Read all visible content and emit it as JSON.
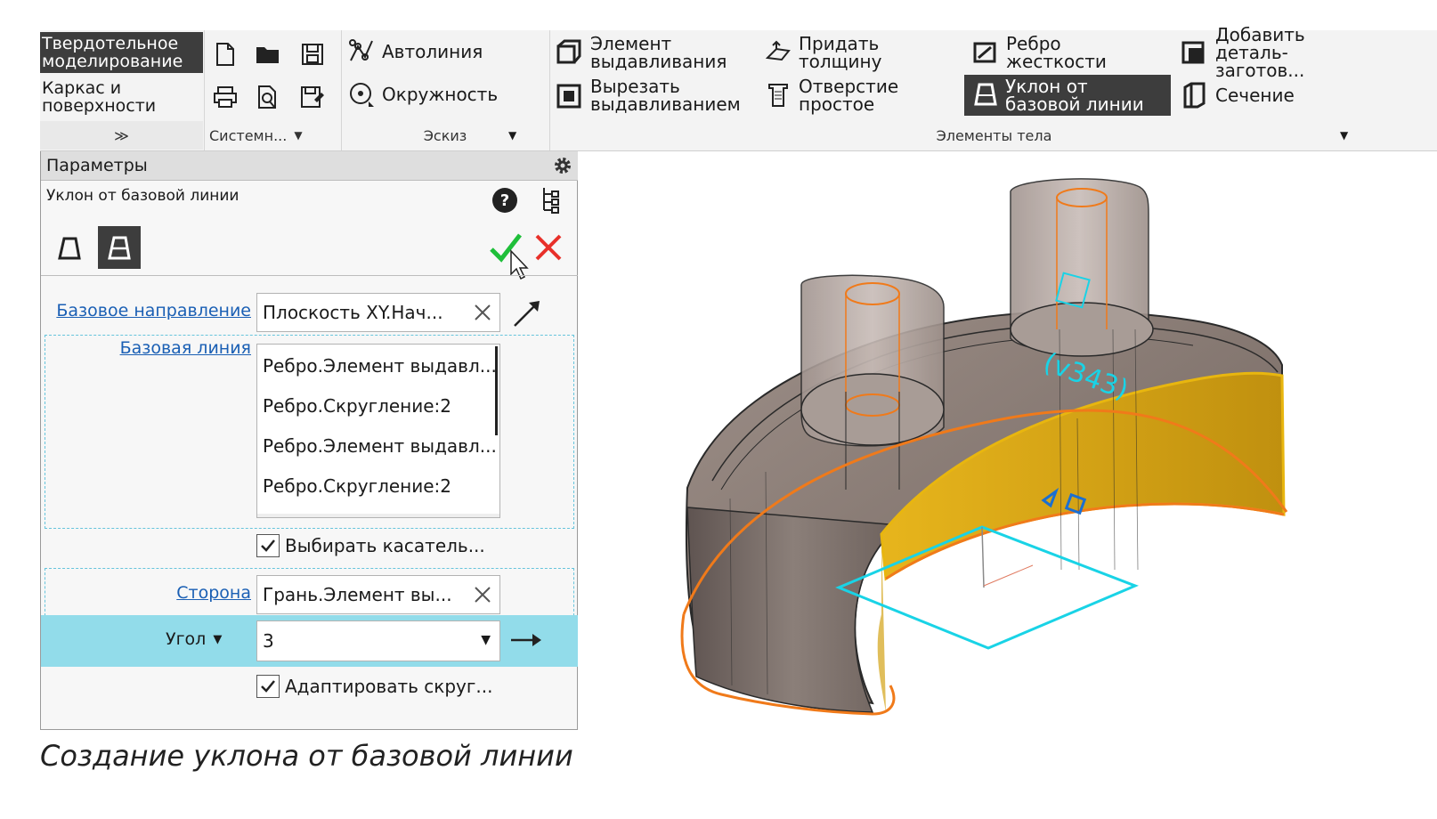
{
  "ribbon": {
    "modes": [
      "Твердотельное моделирование",
      "Каркас и поверхности"
    ],
    "expand_glyph": "≫",
    "system_group_label": "Системн...",
    "sketch": {
      "autoline": "Автолиния",
      "circle": "Окружность",
      "group_label": "Эскиз"
    },
    "body": {
      "extrude": "Элемент выдавливания",
      "cut_extrude": "Вырезать выдавливанием",
      "thicken": "Придать толщину",
      "hole": "Отверстие простое",
      "rib": "Ребро жесткости",
      "draft_base_line": "Уклон от базовой линии",
      "add_blank": "Добавить деталь-заготов...",
      "section": "Сечение",
      "group_label": "Элементы тела"
    },
    "icons": [
      "new-file-icon",
      "open-folder-icon",
      "save-icon",
      "print-icon",
      "preview-icon",
      "save-as-icon",
      "autoline-icon",
      "circle-icon",
      "extrude-icon",
      "cut-extrude-icon",
      "thicken-icon",
      "hole-icon",
      "rib-icon",
      "draft-icon",
      "add-blank-icon",
      "section-icon"
    ]
  },
  "panel": {
    "header": "Параметры",
    "operation": "Уклон от базовой линии",
    "base_direction": {
      "label": "Базовое направление",
      "value": "Плоскость XY.Нач..."
    },
    "base_line": {
      "label": "Базовая линия",
      "items": [
        "Ребро.Элемент выдавл...",
        "Ребро.Скругление:2",
        "Ребро.Элемент выдавл...",
        "Ребро.Скругление:2"
      ]
    },
    "select_tangent": "Выбирать касатель...",
    "side": {
      "label": "Сторона",
      "value": "Грань.Элемент вы..."
    },
    "angle": {
      "label": "Угол",
      "value": "3"
    },
    "adapt_fillets": "Адаптировать скруг..."
  },
  "viewport": {
    "dimension_text": "(v343)"
  },
  "caption": "Создание уклона от базовой линии",
  "colors": {
    "accent_blue": "#1a5fb4",
    "angle_row": "#92dcea",
    "ok_green": "#1fbf3a",
    "cancel_red": "#e8302a",
    "ribbon_selected": "#3d3d3d",
    "highlight_face": "#d3a316",
    "edge_orange": "#f07a1a",
    "sketch_cyan": "#19d3e6"
  }
}
